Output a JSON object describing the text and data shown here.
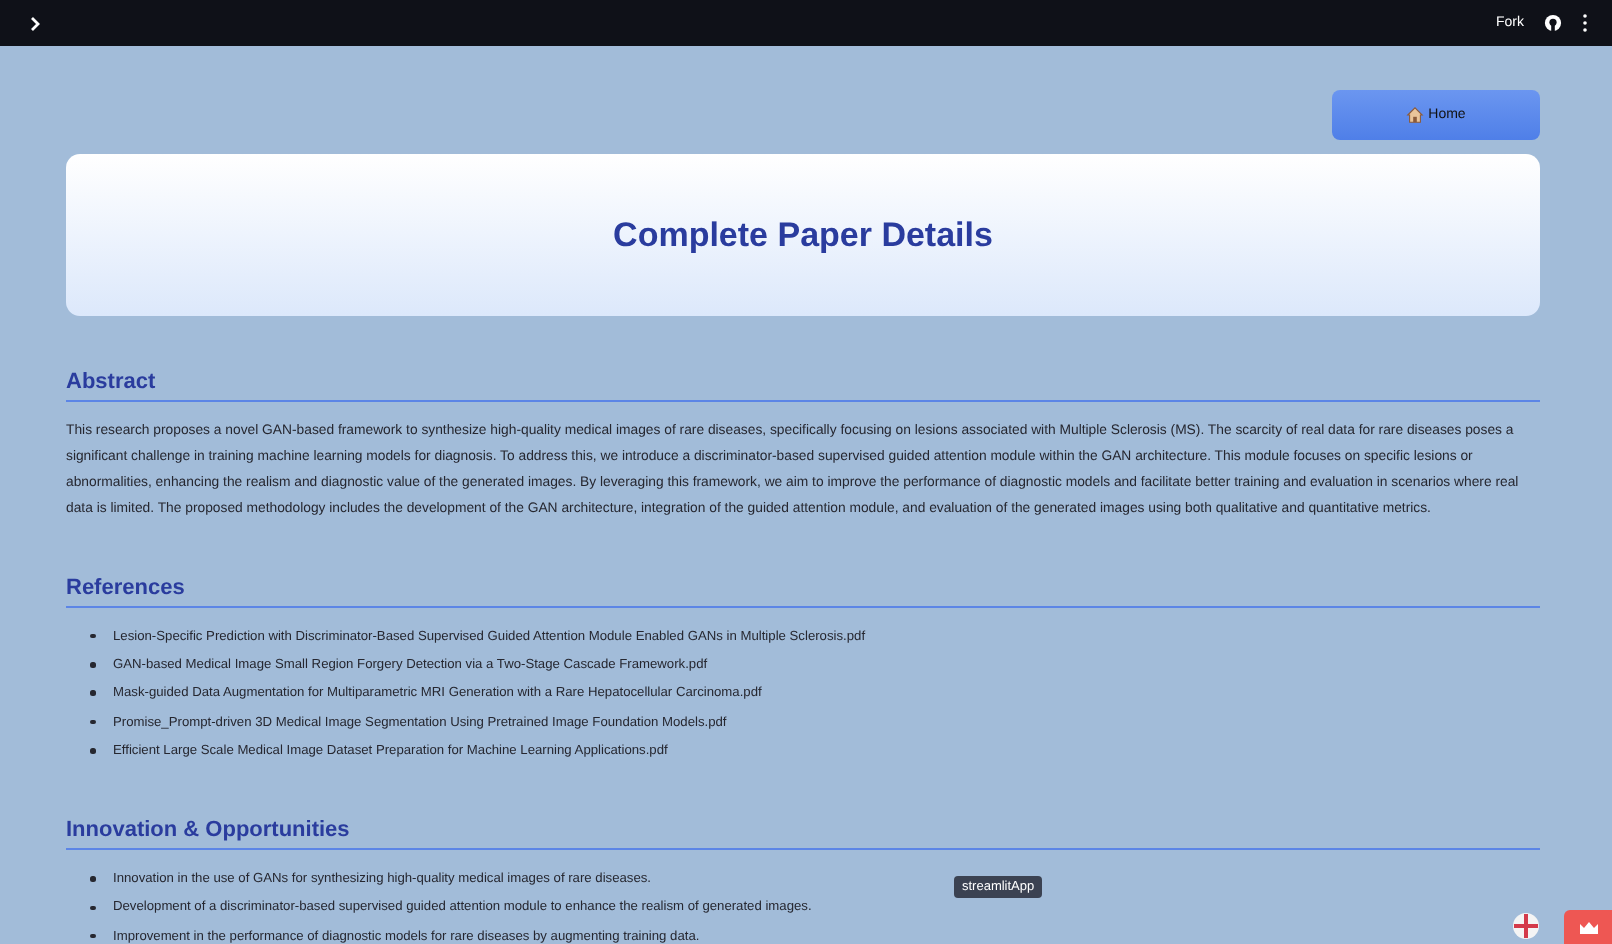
{
  "header": {
    "fork_label": "Fork"
  },
  "home_button": {
    "label": "Home"
  },
  "hero": {
    "title": "Complete Paper Details"
  },
  "sections": [
    {
      "kind": "paragraph",
      "heading": "Abstract",
      "text": "This research proposes a novel GAN-based framework to synthesize high-quality medical images of rare diseases, specifically focusing on lesions associated with Multiple Sclerosis (MS). The scarcity of real data for rare diseases poses a significant challenge in training machine learning models for diagnosis. To address this, we introduce a discriminator-based supervised guided attention module within the GAN architecture. This module focuses on specific lesions or abnormalities, enhancing the realism and diagnostic value of the generated images. By leveraging this framework, we aim to improve the performance of diagnostic models and facilitate better training and evaluation in scenarios where real data is limited. The proposed methodology includes the development of the GAN architecture, integration of the guided attention module, and evaluation of the generated images using both qualitative and quantitative metrics."
    },
    {
      "kind": "list",
      "heading": "References",
      "items": [
        "Lesion-Specific Prediction with Discriminator-Based Supervised Guided Attention Module Enabled GANs in Multiple Sclerosis.pdf",
        "GAN-based Medical Image Small Region Forgery Detection via a Two-Stage Cascade Framework.pdf",
        "Mask-guided Data Augmentation for Multiparametric MRI Generation with a Rare Hepatocellular Carcinoma.pdf",
        "Promise_Prompt-driven 3D Medical Image Segmentation Using Pretrained Image Foundation Models.pdf",
        "Efficient Large Scale Medical Image Dataset Preparation for Machine Learning Applications.pdf"
      ]
    },
    {
      "kind": "list",
      "heading": "Innovation & Opportunities",
      "items": [
        "Innovation in the use of GANs for synthesizing high-quality medical images of rare diseases.",
        "Development of a discriminator-based supervised guided attention module to enhance the realism of generated images.",
        "Improvement in the performance of diagnostic models for rare diseases by augmenting training data."
      ]
    }
  ],
  "tooltip": {
    "text": "streamlitApp"
  }
}
